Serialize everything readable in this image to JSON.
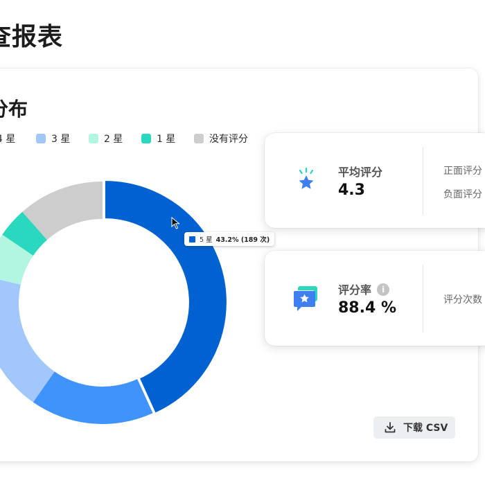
{
  "page": {
    "title": "查报表"
  },
  "card": {
    "title": "分布",
    "download_label": "下载 CSV"
  },
  "legend": [
    {
      "label": "4 星",
      "color": "#0062d0"
    },
    {
      "label": "3 星",
      "color": "#a2c7fb"
    },
    {
      "label": "2 星",
      "color": "#b2f5e0"
    },
    {
      "label": "1 星",
      "color": "#2ad7bf"
    },
    {
      "label": "没有评分",
      "color": "#cdcdcd"
    }
  ],
  "tooltip": {
    "category": "5 星",
    "value": "43.2% (189 次)"
  },
  "stats": {
    "average": {
      "label": "平均评分",
      "value": "4.3",
      "side_1": "正面评分",
      "side_2": "负面评分"
    },
    "rate": {
      "label": "评分率",
      "value": "88.4 %",
      "info": "i",
      "side_1": "评分次数"
    }
  },
  "icons": {
    "avg": "sparkle-star-icon",
    "rate": "rating-chat-icon",
    "download": "download-icon",
    "info": "info-icon",
    "cursor": "mouse-cursor-icon"
  },
  "chart_data": {
    "type": "pie",
    "title": "",
    "categories": [
      "5 星",
      "4 星",
      "3 星",
      "2 星",
      "1 星",
      "没有评分"
    ],
    "values": [
      43.2,
      16.5,
      18.8,
      6.0,
      4.0,
      11.5
    ],
    "units": "%",
    "colors": [
      "#0062d0",
      "#3f93fb",
      "#a2c7fb",
      "#b2f5e0",
      "#2ad7bf",
      "#cdcdcd"
    ],
    "legend_position": "top-left",
    "highlighted": "5 星"
  }
}
